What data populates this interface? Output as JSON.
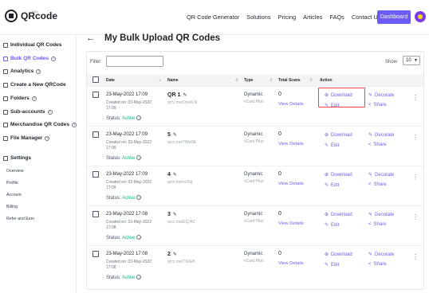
{
  "brand": {
    "name": "QRcode",
    "sub": "Gen"
  },
  "nav": {
    "items": [
      "QR Code Generator",
      "Solutions",
      "Pricing",
      "Articles",
      "FAQs",
      "Contact Us"
    ],
    "dashboard_label": "Dashboard"
  },
  "sidebar": {
    "items": [
      {
        "label": "Individual QR Codes",
        "icon": "list-icon"
      },
      {
        "label": "Bulk QR Codes",
        "icon": "bulk-icon",
        "active": true,
        "help": "?"
      },
      {
        "label": "Analytics",
        "icon": "analytics-icon",
        "help": "?"
      },
      {
        "label": "Create a New QRCode",
        "icon": "plus-icon"
      },
      {
        "label": "Folders",
        "icon": "folder-icon",
        "help": "?"
      },
      {
        "label": "Sub-accounts",
        "icon": "users-icon",
        "help": "?"
      },
      {
        "label": "Merchandise QR Codes",
        "icon": "merch-icon",
        "help": "?"
      },
      {
        "label": "File Manager",
        "icon": "file-icon",
        "help": "?"
      },
      {
        "label": "Settings",
        "icon": "gear-icon"
      }
    ],
    "settings_sub": [
      "Overview",
      "Profile",
      "Account",
      "Billing",
      "Refer and Earn"
    ]
  },
  "main": {
    "title": "My Bulk Upload QR Codes",
    "filter_label": "Filter",
    "filter_placeholder": "",
    "show_label": "Show",
    "show_value": "10",
    "columns": [
      "Date",
      "Name",
      "Type",
      "Total Scans",
      "Action"
    ],
    "action_labels": {
      "download": "Download",
      "decorate": "Decorate",
      "edit": "Edit",
      "share": "Share"
    },
    "rows": [
      {
        "date": "23-May-2022 17:09",
        "created": "Created on: 23-May-2022 17:09",
        "status_label": "Status:",
        "status": "Active",
        "name": "QR 1",
        "url": "qrcc.me/Ozx4LN",
        "type": "Dynamic",
        "type_sub": "vCard Plus",
        "scans": "0",
        "view": "View Details"
      },
      {
        "date": "23-May-2022 17:09",
        "created": "Created on: 23-May-2022 17:09",
        "status_label": "Status:",
        "status": "Active",
        "name": "5",
        "url": "qrcc.me/7WeNE",
        "type": "Dynamic",
        "type_sub": "vCard Plus",
        "scans": "0",
        "view": "View Details"
      },
      {
        "date": "23-May-2022 17:09",
        "created": "Created on: 23-May-2022 17:09",
        "status_label": "Status:",
        "status": "Active",
        "name": "4",
        "url": "qrcc.me/nc0Ig",
        "type": "Dynamic",
        "type_sub": "vCard Plus",
        "scans": "0",
        "view": "View Details"
      },
      {
        "date": "23-May-2022 17:08",
        "created": "Created on: 23-May-2022 17:08",
        "status_label": "Status:",
        "status": "Active",
        "name": "3",
        "url": "qrcc.me/EQJ4Z",
        "type": "Dynamic",
        "type_sub": "vCard Plus",
        "scans": "0",
        "view": "View Details"
      },
      {
        "date": "23-May-2022 17:08",
        "created": "Created on: 23-May-2022 17:08",
        "status_label": "Status:",
        "status": "Active",
        "name": "2",
        "url": "qrcc.me/7XkEB",
        "type": "Dynamic",
        "type_sub": "vCard Plus",
        "scans": "0",
        "view": "View Details"
      }
    ]
  },
  "colors": {
    "accent": "#6b5cf6",
    "active": "#10b981",
    "highlight": "#ef4444"
  }
}
